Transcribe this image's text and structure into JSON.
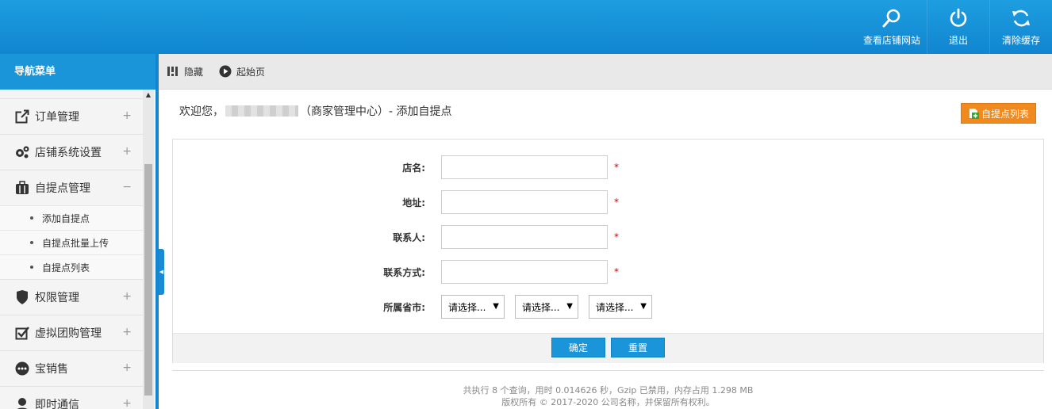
{
  "header": {
    "actions": [
      {
        "label": "查看店铺网站",
        "icon": "search-icon"
      },
      {
        "label": "退出",
        "icon": "power-icon"
      },
      {
        "label": "清除缓存",
        "icon": "refresh-icon"
      }
    ]
  },
  "sidebar": {
    "title": "导航菜单",
    "items": [
      {
        "label": "订单管理",
        "icon": "external-link-icon",
        "toggle": "+"
      },
      {
        "label": "店铺系统设置",
        "icon": "gears-icon",
        "toggle": "+"
      },
      {
        "label": "自提点管理",
        "icon": "briefcase-icon",
        "toggle": "−"
      },
      {
        "label": "权限管理",
        "icon": "shield-icon",
        "toggle": "+"
      },
      {
        "label": "虚拟团购管理",
        "icon": "checkbox-icon",
        "toggle": "+"
      },
      {
        "label": "宝销售",
        "icon": "more-dots-icon",
        "toggle": "+"
      },
      {
        "label": "即时通信",
        "icon": "user-icon",
        "toggle": "+"
      }
    ],
    "submenu": [
      {
        "label": "添加自提点"
      },
      {
        "label": "自提点批量上传"
      },
      {
        "label": "自提点列表"
      }
    ]
  },
  "toolbar": {
    "hide_label": "隐藏",
    "home_label": "起始页"
  },
  "content": {
    "welcome_prefix": "欢迎您，",
    "welcome_suffix": "（商家管理中心）- 添加自提点",
    "list_button": "自提点列表"
  },
  "form": {
    "fields": [
      {
        "label": "店名:",
        "value": "",
        "required": "*"
      },
      {
        "label": "地址:",
        "value": "",
        "required": "*"
      },
      {
        "label": "联系人:",
        "value": "",
        "required": "*"
      },
      {
        "label": "联系方式:",
        "value": "",
        "required": "*"
      }
    ],
    "region_label": "所属省市:",
    "region_selects": [
      "请选择...",
      "请选择...",
      "请选择..."
    ],
    "submit_label": "确定",
    "reset_label": "重置"
  },
  "footer": {
    "stats": "共执行 8 个查询，用时 0.014626 秒，Gzip 已禁用，内存占用 1.298 MB",
    "copyright": "版权所有 © 2017-2020 公司名称，并保留所有权利。"
  },
  "colors": {
    "header_blue": "#1185d0",
    "accent_orange": "#f0891e",
    "required_red": "#cc0000"
  }
}
